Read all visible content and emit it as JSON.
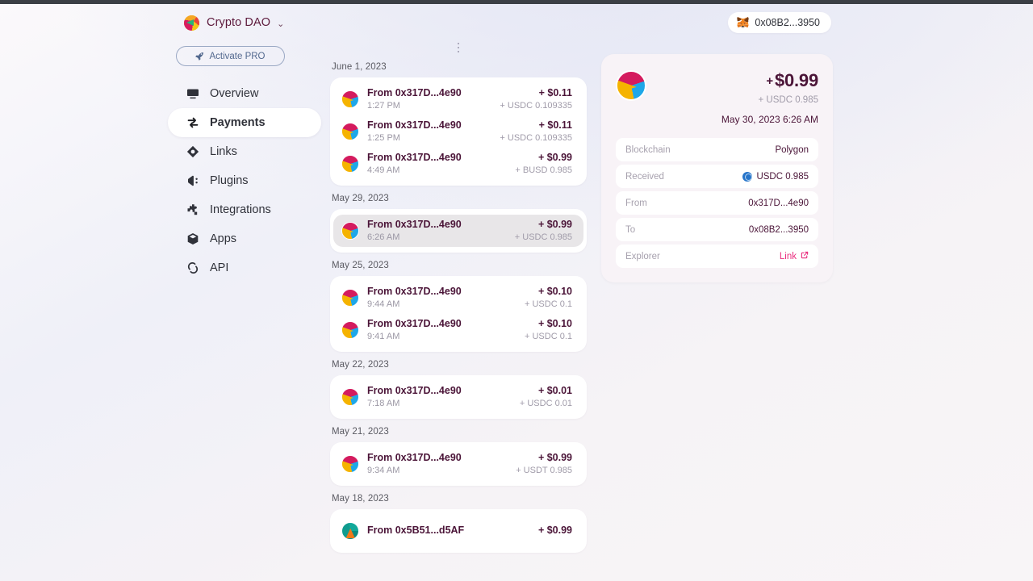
{
  "brand": {
    "name": "Crypto DAO",
    "caret": "⌄",
    "logo_icon": "crypto-dao-logo"
  },
  "pro_button": {
    "label": "Activate PRO",
    "icon": "rocket-icon"
  },
  "sidebar": {
    "items": [
      {
        "label": "Overview",
        "icon": "monitor-icon",
        "active": false
      },
      {
        "label": "Payments",
        "icon": "transfer-icon",
        "active": true
      },
      {
        "label": "Links",
        "icon": "diamond-link-icon",
        "active": false
      },
      {
        "label": "Plugins",
        "icon": "plug-icon",
        "active": false
      },
      {
        "label": "Integrations",
        "icon": "puzzle-icon",
        "active": false
      },
      {
        "label": "Apps",
        "icon": "cube-icon",
        "active": false
      },
      {
        "label": "API",
        "icon": "api-icon",
        "active": false
      }
    ]
  },
  "wallet": {
    "address": "0x08B2...3950",
    "icon": "metamask-fox-icon"
  },
  "feed": {
    "menu_icon": "more-vertical-icon",
    "groups": [
      {
        "date": "June 1, 2023",
        "rows": [
          {
            "title": "From 0x317D...4e90",
            "time": "1:27 PM",
            "amount": "+ $0.11",
            "token": "+ USDC 0.109335",
            "avatar": "av-a",
            "selected": false
          },
          {
            "title": "From 0x317D...4e90",
            "time": "1:25 PM",
            "amount": "+ $0.11",
            "token": "+ USDC 0.109335",
            "avatar": "av-a",
            "selected": false
          },
          {
            "title": "From 0x317D...4e90",
            "time": "4:49 AM",
            "amount": "+ $0.99",
            "token": "+ BUSD 0.985",
            "avatar": "av-a",
            "selected": false
          }
        ]
      },
      {
        "date": "May 29, 2023",
        "rows": [
          {
            "title": "From 0x317D...4e90",
            "time": "6:26 AM",
            "amount": "+ $0.99",
            "token": "+ USDC 0.985",
            "avatar": "av-a",
            "selected": true
          }
        ]
      },
      {
        "date": "May 25, 2023",
        "rows": [
          {
            "title": "From 0x317D...4e90",
            "time": "9:44 AM",
            "amount": "+ $0.10",
            "token": "+ USDC 0.1",
            "avatar": "av-a",
            "selected": false
          },
          {
            "title": "From 0x317D...4e90",
            "time": "9:41 AM",
            "amount": "+ $0.10",
            "token": "+ USDC 0.1",
            "avatar": "av-a",
            "selected": false
          }
        ]
      },
      {
        "date": "May 22, 2023",
        "rows": [
          {
            "title": "From 0x317D...4e90",
            "time": "7:18 AM",
            "amount": "+ $0.01",
            "token": "+ USDC 0.01",
            "avatar": "av-a",
            "selected": false
          }
        ]
      },
      {
        "date": "May 21, 2023",
        "rows": [
          {
            "title": "From 0x317D...4e90",
            "time": "9:34 AM",
            "amount": "+ $0.99",
            "token": "+ USDT 0.985",
            "avatar": "av-a",
            "selected": false
          }
        ]
      },
      {
        "date": "May 18, 2023",
        "rows": [
          {
            "title": "From 0x5B51...d5AF",
            "time": "",
            "amount": "+ $0.99",
            "token": "",
            "avatar": "av-b",
            "selected": false
          }
        ]
      }
    ]
  },
  "detail": {
    "avatar_icon": "payment-avatar",
    "plus": "+",
    "amount": "$0.99",
    "token": "+ USDC 0.985",
    "datetime": "May 30, 2023 6:26 AM",
    "rows": [
      {
        "key": "Blockchain",
        "value": "Polygon",
        "icon": null,
        "link": false
      },
      {
        "key": "Received",
        "value": "USDC 0.985",
        "icon": "usdc-coin-icon",
        "link": false
      },
      {
        "key": "From",
        "value": "0x317D...4e90",
        "icon": null,
        "link": false
      },
      {
        "key": "To",
        "value": "0x08B2...3950",
        "icon": null,
        "link": false
      },
      {
        "key": "Explorer",
        "value": "Link",
        "icon": "external-link-icon",
        "link": true
      }
    ]
  },
  "colors": {
    "accent_pink": "#ea2e7e",
    "text_plum": "#4b1538",
    "muted": "#a09ba9",
    "pro_blue": "#53698f"
  }
}
